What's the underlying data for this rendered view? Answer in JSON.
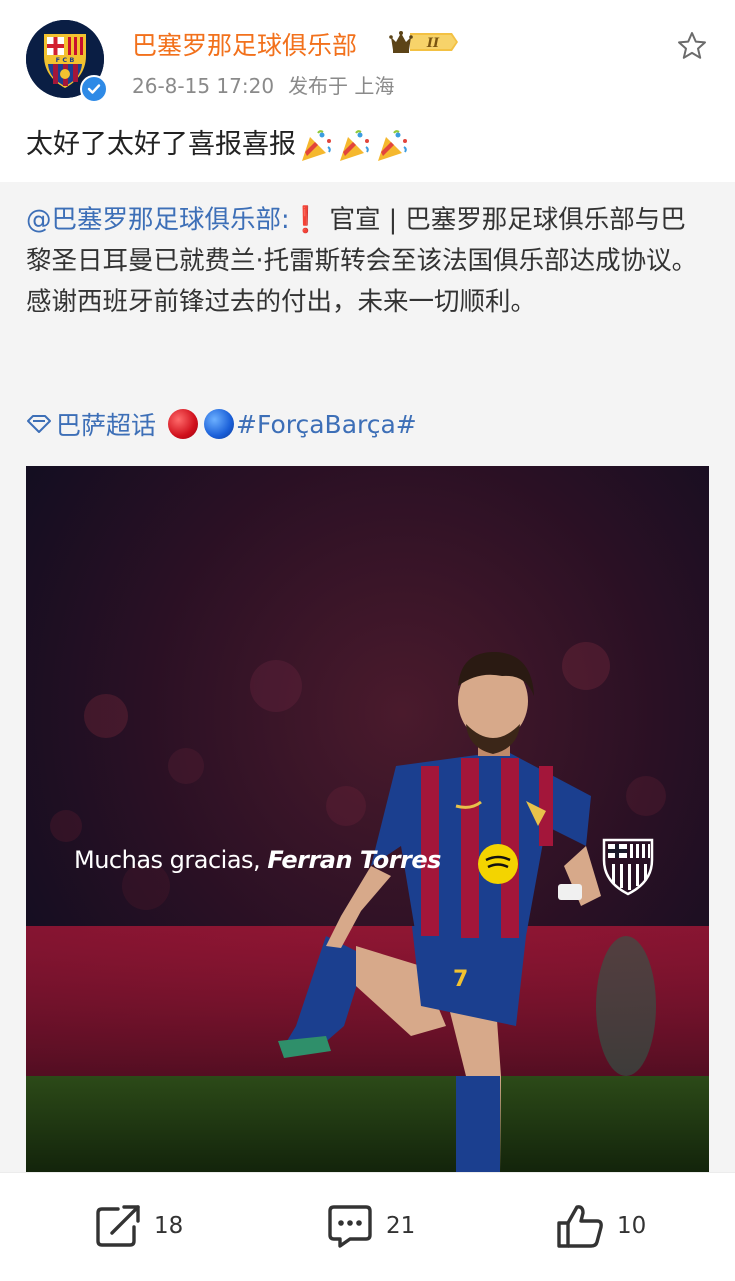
{
  "post": {
    "author": "巴塞罗那足球俱乐部",
    "badge_text": "II",
    "time": "26-8-15 17:20",
    "location": "发布于 上海",
    "text": "太好了太好了喜报喜报"
  },
  "repost": {
    "mention": "@巴塞罗那足球俱乐部:",
    "exclaim": "❗",
    "body": " 官宣 | 巴塞罗那足球俱乐部与巴黎圣日耳曼已就费兰·托雷斯转会至该法国俱乐部达成协议。感谢西班牙前锋过去的付出，未来一切顺利。",
    "topic_label": "巴萨超话",
    "hashtag": "#ForçaBarça#"
  },
  "image": {
    "caption_plain": "Muchas gracias, ",
    "caption_bold": "Ferran Torres",
    "shirt_number": "7"
  },
  "actions": {
    "share_count": "18",
    "comment_count": "21",
    "like_count": "10"
  },
  "colors": {
    "author": "#f2711c",
    "link": "#3d6fb7",
    "barca_blue": "#1b3f8f",
    "barca_red": "#a3163a"
  }
}
